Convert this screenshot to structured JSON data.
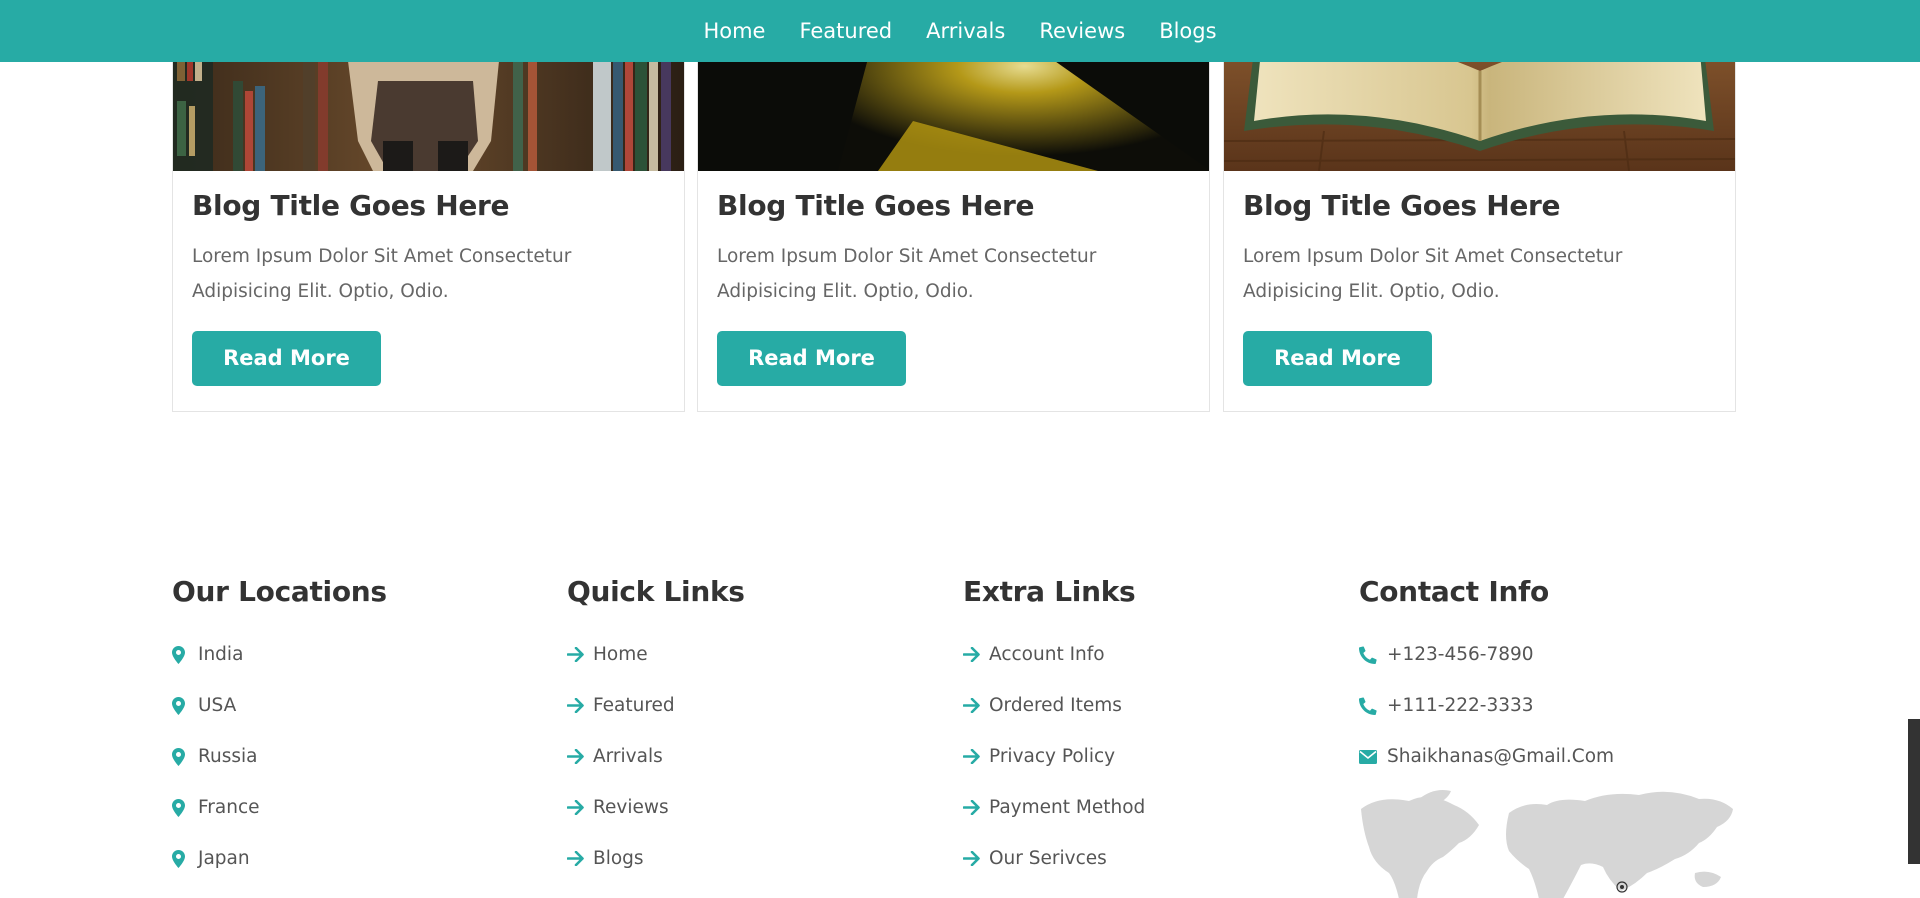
{
  "nav": {
    "items": [
      "Home",
      "Featured",
      "Arrivals",
      "Reviews",
      "Blogs"
    ]
  },
  "blogs": [
    {
      "title": "Blog Title Goes Here",
      "text": "Lorem Ipsum Dolor Sit Amet Consectetur Adipisicing Elit. Optio, Odio.",
      "button": "Read More"
    },
    {
      "title": "Blog Title Goes Here",
      "text": "Lorem Ipsum Dolor Sit Amet Consectetur Adipisicing Elit. Optio, Odio.",
      "button": "Read More"
    },
    {
      "title": "Blog Title Goes Here",
      "text": "Lorem Ipsum Dolor Sit Amet Consectetur Adipisicing Elit. Optio, Odio.",
      "button": "Read More"
    }
  ],
  "footer": {
    "locations": {
      "title": "Our Locations",
      "items": [
        "India",
        "USA",
        "Russia",
        "France",
        "Japan"
      ]
    },
    "quick_links": {
      "title": "Quick Links",
      "items": [
        "Home",
        "Featured",
        "Arrivals",
        "Reviews",
        "Blogs"
      ]
    },
    "extra_links": {
      "title": "Extra Links",
      "items": [
        "Account Info",
        "Ordered Items",
        "Privacy Policy",
        "Payment Method",
        "Our Serivces"
      ]
    },
    "contact": {
      "title": "Contact Info",
      "phone1": "+123-456-7890",
      "phone2": "+111-222-3333",
      "email": "Shaikhanas@Gmail.Com"
    }
  },
  "colors": {
    "accent": "#27aba5",
    "heading": "#333333",
    "text": "#666666"
  },
  "icons": {
    "location": "map-marker-icon",
    "link": "arrow-right-icon",
    "phone": "phone-icon",
    "email": "envelope-icon"
  }
}
